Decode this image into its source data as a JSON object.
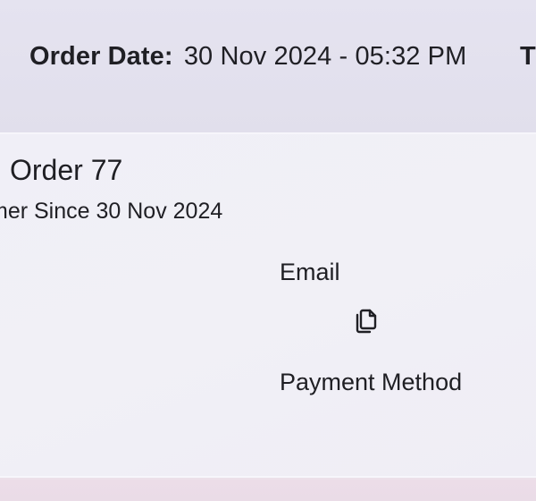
{
  "header": {
    "order_date_label": "Order Date:",
    "order_date_value": "30 Nov 2024 - 05:32 PM",
    "next_label_fragment": "T"
  },
  "order": {
    "title": "Order 77",
    "customer_since": "mer Since 30 Nov 2024",
    "email_label": "Email",
    "copy_icon": "copy-icon",
    "payment_method_label": "Payment Method"
  },
  "colors": {
    "text": "#1f1f24",
    "card_background": "#f0eff7",
    "header_background": "#e3e1ee",
    "bottom_background": "#ecdde8"
  }
}
